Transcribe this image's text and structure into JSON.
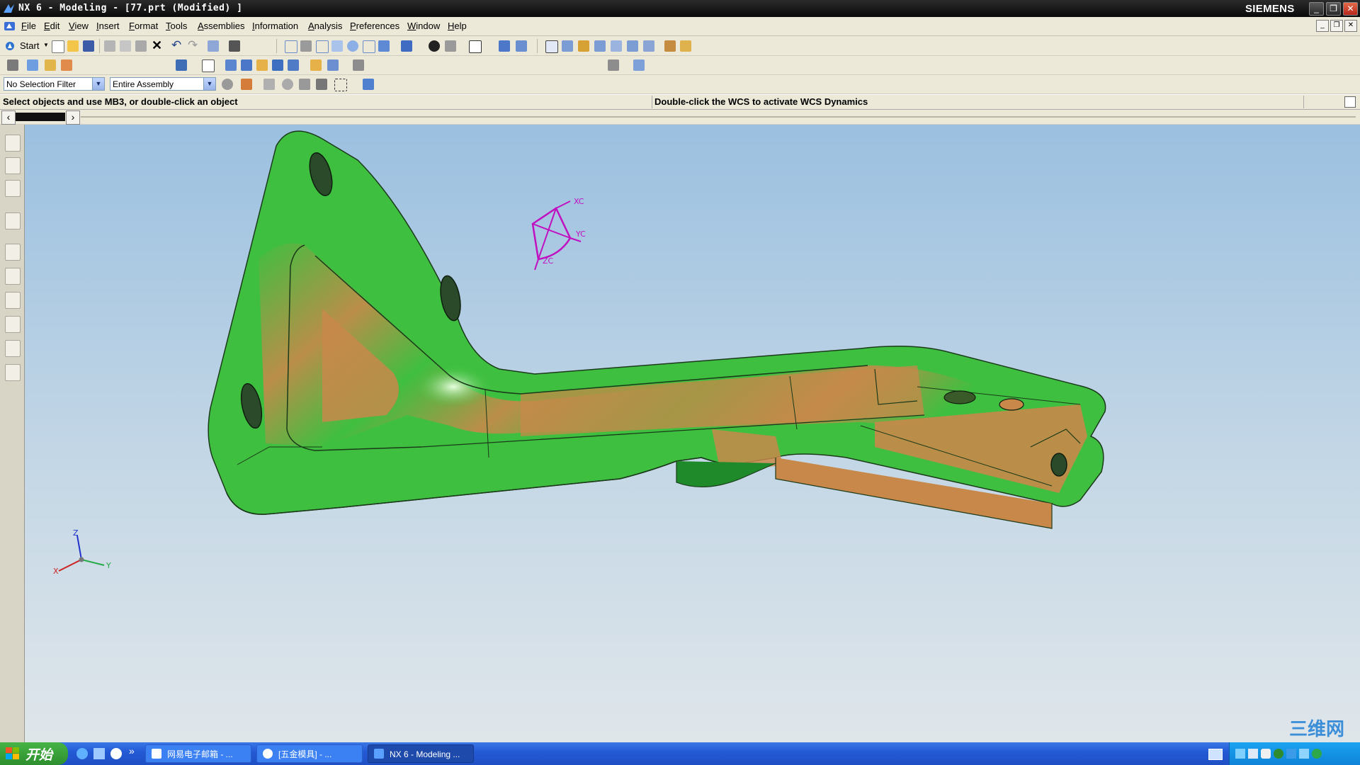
{
  "window": {
    "title": "NX 6 - Modeling - [77.prt (Modified) ]",
    "brand": "SIEMENS",
    "controls": {
      "minimize": "_",
      "restore": "❐",
      "close": "✕"
    }
  },
  "menubar": {
    "items": [
      "File",
      "Edit",
      "View",
      "Insert",
      "Format",
      "Tools",
      "Assemblies",
      "Information",
      "Analysis",
      "Preferences",
      "Window",
      "Help"
    ]
  },
  "toolbar": {
    "start_label": "Start",
    "selection_filter": "No Selection Filter",
    "assembly_scope": "Entire Assembly"
  },
  "statusbar": {
    "prompt": "Select objects and use MB3, or double-click an object",
    "hint": "Double-click the WCS to activate WCS Dynamics"
  },
  "viewport": {
    "wcs": {
      "x": "XC",
      "y": "YC",
      "z": "ZC"
    },
    "triad": {
      "x": "X",
      "y": "Y",
      "z": "Z"
    },
    "watermark": "三维网",
    "colors": {
      "wcs": "#c010c0",
      "face_green": "#3fbf3f",
      "face_orange": "#c8884a"
    }
  },
  "taskbar": {
    "start_label": "开始",
    "overflow": "»",
    "tasks": [
      {
        "label": "网易电子邮箱 - ...",
        "active": false
      },
      {
        "label": "[五金模具] - ...",
        "active": false
      },
      {
        "label": "NX 6 - Modeling ...",
        "active": true
      }
    ]
  }
}
